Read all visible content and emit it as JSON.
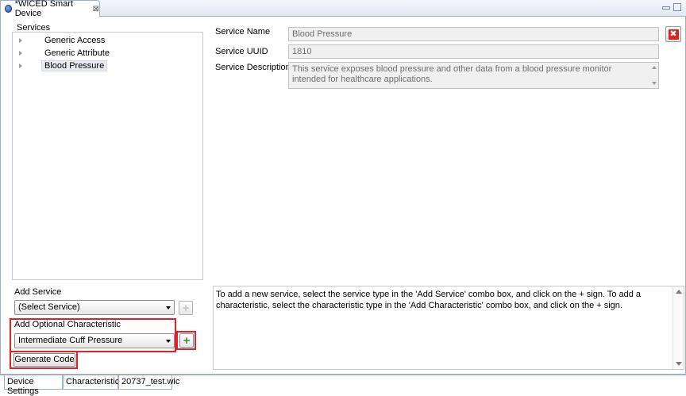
{
  "editor_tab": {
    "title": "*WICED Smart Device",
    "close": "⊠"
  },
  "services": {
    "label": "Services",
    "items": [
      {
        "label": "Generic Access"
      },
      {
        "label": "Generic Attribute"
      },
      {
        "label": "Blood Pressure"
      }
    ]
  },
  "detail": {
    "name_label": "Service Name",
    "name_value": "Blood Pressure",
    "uuid_label": "Service UUID",
    "uuid_value": "1810",
    "desc_label": "Service Description",
    "desc_value": "This service exposes blood pressure and other data from a blood pressure monitor intended for healthcare applications.",
    "delete_glyph": "✖"
  },
  "help": {
    "text": "To add a new service, select the service type in the 'Add Service' combo box, and click on the + sign. To add a characteristic, select the characteristic type in the 'Add Characteristic' combo box, and click on the + sign."
  },
  "add_service": {
    "label": "Add Service",
    "value": "(Select Service)",
    "plus": "+"
  },
  "add_characteristic": {
    "label": "Add Optional Characteristic",
    "value": "Intermediate Cuff Pressure",
    "plus": "+"
  },
  "generate_button": "Generate Code",
  "bottom_tabs": [
    {
      "label": "Device Settings"
    },
    {
      "label": "Characteristics"
    },
    {
      "label": "20737_test.wic"
    }
  ],
  "colors": {
    "highlight_red": "#e0202a",
    "plus_green": "#2f9a2f",
    "delete_red": "#d9231b"
  }
}
